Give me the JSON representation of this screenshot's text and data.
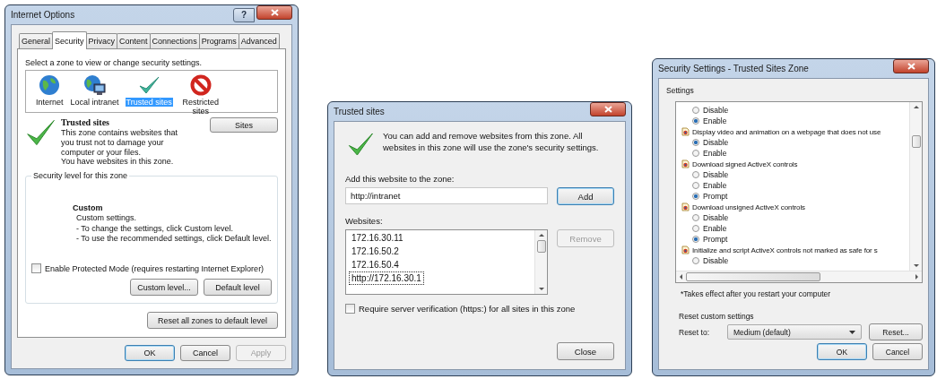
{
  "internet_options": {
    "title": "Internet Options",
    "help_button": "?",
    "tabs": [
      {
        "label": "General",
        "selected": false
      },
      {
        "label": "Security",
        "selected": true
      },
      {
        "label": "Privacy",
        "selected": false
      },
      {
        "label": "Content",
        "selected": false
      },
      {
        "label": "Connections",
        "selected": false
      },
      {
        "label": "Programs",
        "selected": false
      },
      {
        "label": "Advanced",
        "selected": false
      }
    ],
    "zone_prompt": "Select a zone to view or change security settings.",
    "zones": [
      {
        "label": "Internet",
        "kind": "globe",
        "selected": false
      },
      {
        "label": "Local intranet",
        "kind": "intranet",
        "selected": false
      },
      {
        "label": "Trusted sites",
        "kind": "check",
        "selected": true
      },
      {
        "label": "Restricted sites",
        "kind": "restricted",
        "selected": false
      }
    ],
    "zone_heading": "Trusted sites",
    "zone_description": "This zone contains websites that you trust not to damage your computer or your files.",
    "zone_status": "You have websites in this zone.",
    "sites_button": "Sites",
    "level_legend": "Security level for this zone",
    "level_name": "Custom",
    "level_lines": [
      "Custom settings.",
      "- To change the settings, click Custom level.",
      "- To use the recommended settings, click Default level."
    ],
    "protected_mode": {
      "label": "Enable Protected Mode (requires restarting Internet Explorer)",
      "checked": false
    },
    "level_buttons": [
      "Custom level...",
      "Default level"
    ],
    "reset_all_button": "Reset all zones to default level",
    "footer_buttons": [
      {
        "label": "OK",
        "default": true,
        "disabled": false
      },
      {
        "label": "Cancel",
        "default": false,
        "disabled": false
      },
      {
        "label": "Apply",
        "default": false,
        "disabled": true
      }
    ]
  },
  "trusted_sites": {
    "title": "Trusted sites",
    "intro": "You can add and remove websites from this zone. All websites in this zone will use the zone's security settings.",
    "add_label": "Add this website to the zone:",
    "add_value": "http://intranet",
    "add_button": {
      "label": "Add",
      "default": true
    },
    "websites_label": "Websites:",
    "websites": [
      {
        "text": "172.16.30.11",
        "focused": false
      },
      {
        "text": "172.16.50.2",
        "focused": false
      },
      {
        "text": "172.16.50.4",
        "focused": false
      },
      {
        "text": "http://172.16.30.1",
        "focused": true
      }
    ],
    "remove_button": {
      "label": "Remove",
      "disabled": true
    },
    "require_https": {
      "label": "Require server verification (https:) for all sites in this zone",
      "checked": false
    },
    "close_button": "Close"
  },
  "security_settings": {
    "title": "Security Settings - Trusted Sites Zone",
    "settings_label": "Settings",
    "settings": [
      {
        "options": [
          {
            "label": "Disable",
            "checked": false
          },
          {
            "label": "Enable",
            "checked": true
          }
        ]
      },
      {
        "heading": "Display video and animation on a webpage that does not use",
        "options": [
          {
            "label": "Disable",
            "checked": true
          },
          {
            "label": "Enable",
            "checked": false
          }
        ]
      },
      {
        "heading": "Download signed ActiveX controls",
        "options": [
          {
            "label": "Disable",
            "checked": false
          },
          {
            "label": "Enable",
            "checked": false
          },
          {
            "label": "Prompt",
            "checked": true
          }
        ]
      },
      {
        "heading": "Download unsigned ActiveX controls",
        "options": [
          {
            "label": "Disable",
            "checked": false
          },
          {
            "label": "Enable",
            "checked": false
          },
          {
            "label": "Prompt",
            "checked": true
          }
        ]
      },
      {
        "heading": "Initialize and script ActiveX controls not marked as safe for s",
        "options": [
          {
            "label": "Disable",
            "checked": false
          }
        ]
      }
    ],
    "note": "*Takes effect after you restart your computer",
    "reset_group": "Reset custom settings",
    "reset_to_label": "Reset to:",
    "reset_value": "Medium (default)",
    "reset_button": "Reset...",
    "footer_buttons": [
      {
        "label": "OK",
        "default": true,
        "disabled": false
      },
      {
        "label": "Cancel",
        "default": false,
        "disabled": false
      }
    ]
  }
}
